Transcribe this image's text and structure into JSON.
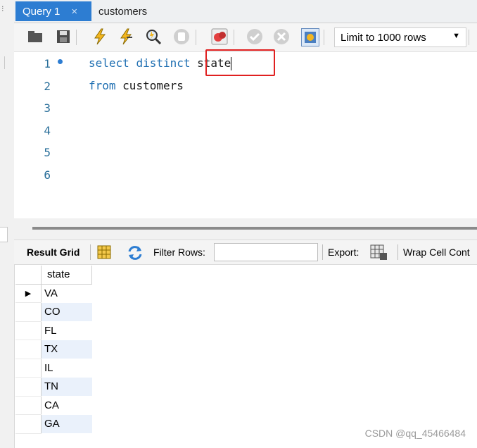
{
  "tabs": [
    {
      "label": "Query 1",
      "close": "×"
    },
    {
      "label": "customers"
    }
  ],
  "toolbar": {
    "limit_label": "Limit to 1000 rows"
  },
  "editor": {
    "line_numbers": [
      "1",
      "2",
      "3",
      "4",
      "5",
      "6"
    ],
    "line1": {
      "kw1": "select",
      "kw2": "distinct",
      "ident": "state"
    },
    "line2": {
      "kw1": "from",
      "ident": "customers"
    }
  },
  "result_bar": {
    "grid_label": "Result Grid",
    "filter_label": "Filter Rows:",
    "filter_value": "",
    "export_label": "Export:",
    "wrap_label": "Wrap Cell Cont"
  },
  "grid": {
    "column": "state",
    "rows": [
      "VA",
      "CO",
      "FL",
      "TX",
      "IL",
      "TN",
      "CA",
      "GA"
    ]
  },
  "watermark": "CSDN @qq_45466484",
  "colors": {
    "tab_active": "#2d7dd2",
    "keyword": "#1f6fb2",
    "highlight_box": "#e02020",
    "alt_row": "#eaf1fb"
  }
}
